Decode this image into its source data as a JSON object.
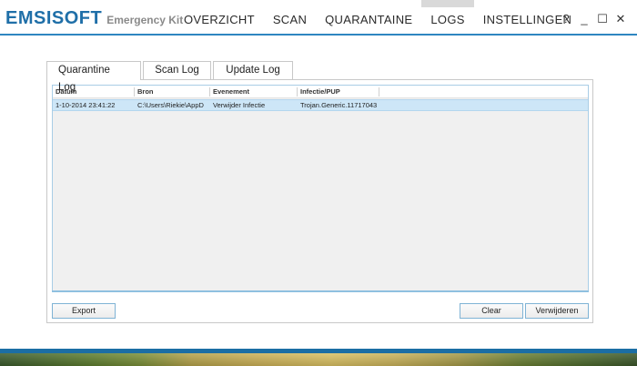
{
  "app": {
    "brand_main": "EMSISOFT",
    "brand_sub": "Emergency Kit",
    "accent_color": "#1f6fa8"
  },
  "nav": {
    "items": [
      "OVERZICHT",
      "SCAN",
      "QUARANTAINE",
      "LOGS",
      "INSTELLINGEN"
    ],
    "active": "LOGS"
  },
  "window_controls": {
    "help": "?",
    "minimize": "_",
    "maximize": "☐",
    "close": "✕"
  },
  "tabs": [
    "Quarantine Log",
    "Scan Log",
    "Update Log"
  ],
  "active_tab": "Quarantine Log",
  "table": {
    "columns": [
      "Datum",
      "Bron",
      "Evenement",
      "Infectie/PUP"
    ],
    "rows": [
      [
        "1-10-2014 23:41:22",
        "C:\\Users\\Riekie\\AppD",
        "Verwijder Infectie",
        "Trojan.Generic.11717043"
      ]
    ]
  },
  "buttons": {
    "export": "Export",
    "clear": "Clear",
    "remove": "Verwijderen"
  }
}
